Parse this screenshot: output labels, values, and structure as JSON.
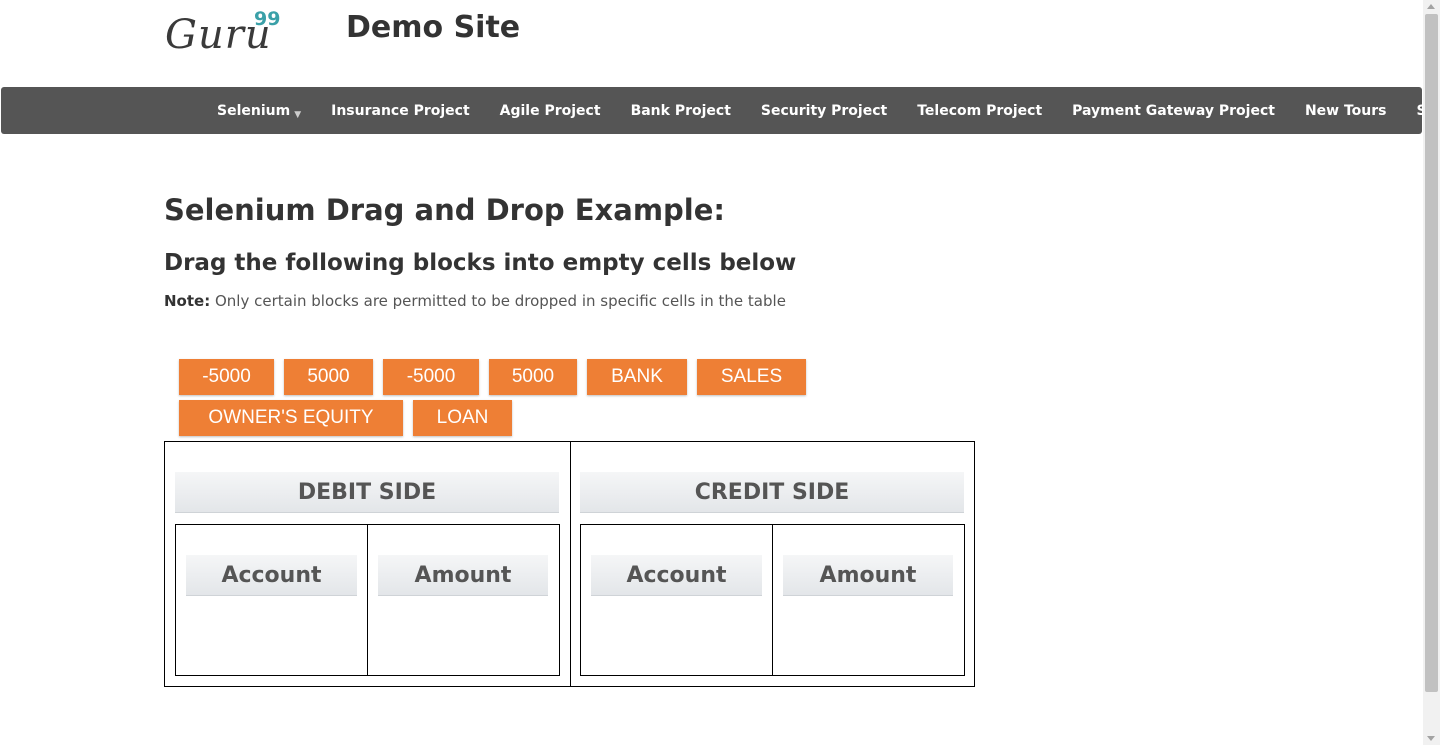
{
  "header": {
    "logo_text": "Guru",
    "logo_sup": "99",
    "site_title": "Demo Site"
  },
  "nav": {
    "items": [
      {
        "label": "Selenium",
        "dropdown": true
      },
      {
        "label": "Insurance Project",
        "dropdown": false
      },
      {
        "label": "Agile Project",
        "dropdown": false
      },
      {
        "label": "Bank Project",
        "dropdown": false
      },
      {
        "label": "Security Project",
        "dropdown": false
      },
      {
        "label": "Telecom Project",
        "dropdown": false
      },
      {
        "label": "Payment Gateway Project",
        "dropdown": false
      },
      {
        "label": "New Tours",
        "dropdown": false
      },
      {
        "label": "SEO",
        "dropdown": true
      }
    ]
  },
  "main": {
    "title": "Selenium Drag and Drop Example:",
    "subtitle": "Drag the following blocks into empty cells below",
    "note_label": "Note:",
    "note_text": " Only certain blocks are permitted to be dropped in specific cells in the table"
  },
  "blocks": [
    "-5000",
    "5000",
    "-5000",
    "5000",
    "BANK",
    "SALES",
    "OWNER'S EQUITY",
    "LOAN"
  ],
  "table": {
    "debit_header": "DEBIT SIDE",
    "credit_header": "CREDIT SIDE",
    "debit_account": "Account",
    "debit_amount": "Amount",
    "credit_account": "Account",
    "credit_amount": "Amount"
  },
  "colors": {
    "block_bg": "#ee7f35",
    "navbar_bg": "#555555",
    "logo_accent": "#3aa0a8"
  }
}
